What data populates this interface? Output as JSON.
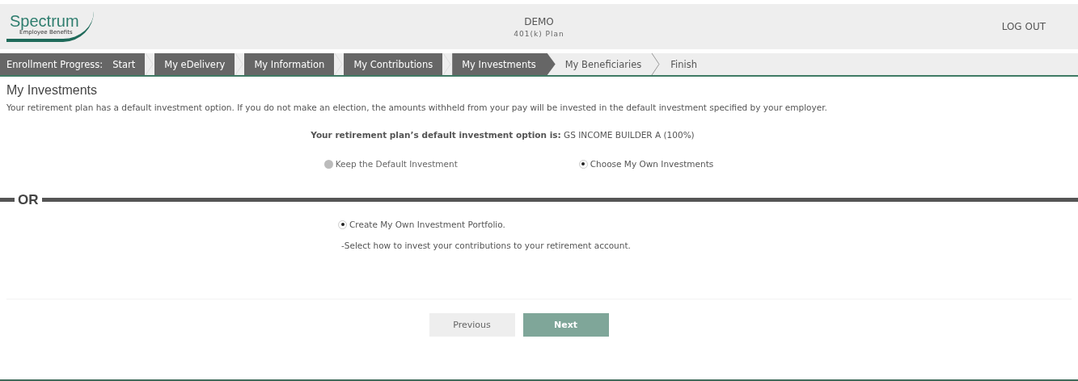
{
  "header": {
    "logo": {
      "name": "Spectrum",
      "tagline": "Employee Benefits"
    },
    "title": "DEMO",
    "subtitle": "401(k) Plan",
    "logout": "LOG OUT"
  },
  "progress": {
    "label": "Enrollment Progress:",
    "steps": [
      {
        "label": "Start",
        "done": true
      },
      {
        "label": "My eDelivery",
        "done": true
      },
      {
        "label": "My Information",
        "done": true
      },
      {
        "label": "My Contributions",
        "done": true
      },
      {
        "label": "My Investments",
        "done": true
      },
      {
        "label": "My Beneficiaries",
        "done": false
      },
      {
        "label": "Finish",
        "done": false
      }
    ]
  },
  "page": {
    "heading": "My Investments",
    "intro": "Your retirement plan has a default investment option. If you do not make an election, the amounts withheld from your pay will be invested in the default investment specified by your employer.",
    "default_label": "Your retirement plan’s default investment option is:",
    "default_value": "GS INCOME BUILDER A (100%)"
  },
  "choices": [
    {
      "label": "Keep the Default Investment",
      "selected": false,
      "disabled": true
    },
    {
      "label": "Choose My Own Investments",
      "selected": true,
      "disabled": false
    }
  ],
  "divider": "OR",
  "portfolio": {
    "label": "Create My Own Investment Portfolio.",
    "selected": true,
    "note": "-Select how to invest your contributions to your retirement account."
  },
  "buttons": [
    {
      "label": "Previous",
      "kind": "secondary"
    },
    {
      "label": "Next",
      "kind": "primary"
    }
  ]
}
